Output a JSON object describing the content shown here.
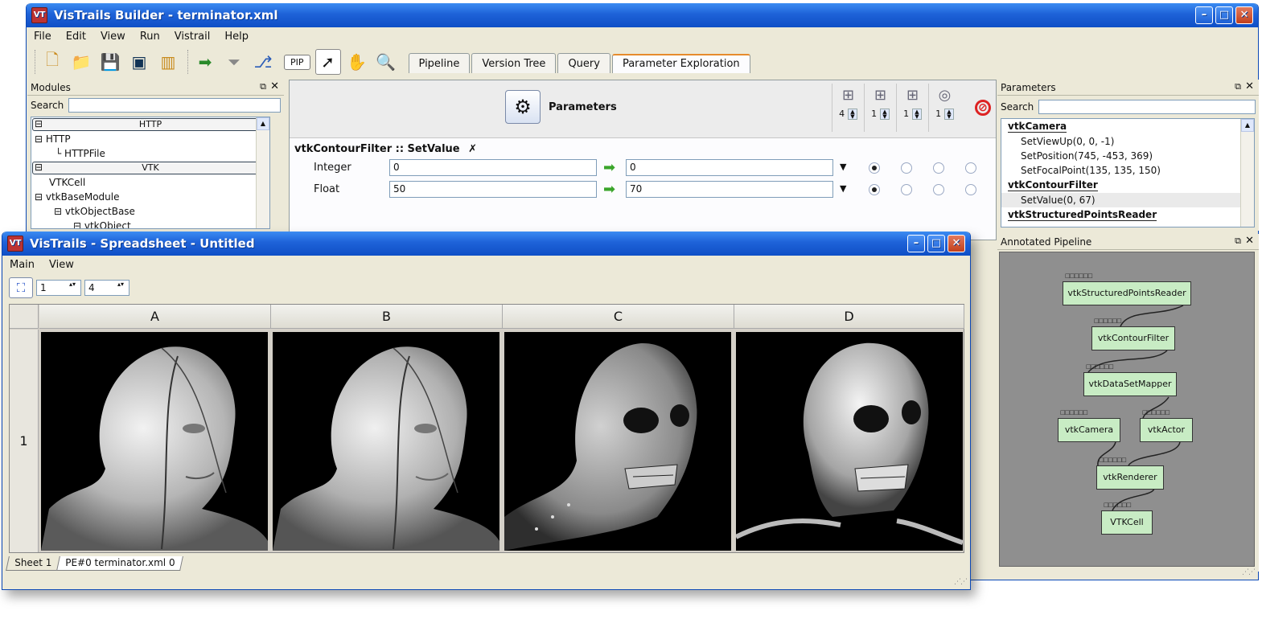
{
  "builder": {
    "title": "VisTrails Builder - terminator.xml",
    "menu": [
      "File",
      "Edit",
      "View",
      "Run",
      "Vistrail",
      "Help"
    ],
    "pip_label": "PIP",
    "tabs": [
      "Pipeline",
      "Version Tree",
      "Query",
      "Parameter Exploration"
    ],
    "active_tab": "Parameter Exploration",
    "modules_panel": {
      "title": "Modules",
      "search_label": "Search",
      "items": [
        {
          "type": "category",
          "label": "HTTP"
        },
        {
          "type": "item",
          "label": "HTTP",
          "indent": 1
        },
        {
          "type": "item",
          "label": "HTTPFile",
          "indent": 3
        },
        {
          "type": "category",
          "label": "VTK"
        },
        {
          "type": "item",
          "label": "VTKCell",
          "indent": 1
        },
        {
          "type": "item",
          "label": "vtkBaseModule",
          "indent": 1
        },
        {
          "type": "item",
          "label": "vtkObjectBase",
          "indent": 2
        },
        {
          "type": "item",
          "label": "vtkObject",
          "indent": 3
        }
      ]
    },
    "exploration": {
      "header_title": "Parameters",
      "dimensions": [
        {
          "value": "4"
        },
        {
          "value": "1"
        },
        {
          "value": "1"
        },
        {
          "value": "1"
        }
      ],
      "function_label": "vtkContourFilter :: SetValue",
      "rows": [
        {
          "label": "Integer",
          "start": "0",
          "end": "0",
          "selected_dim": 0
        },
        {
          "label": "Float",
          "start": "50",
          "end": "70",
          "selected_dim": 0
        }
      ]
    },
    "parameters_panel": {
      "title": "Parameters",
      "search_label": "Search",
      "groups": [
        {
          "name": "vtkCamera",
          "items": [
            "SetViewUp(0, 0, -1)",
            "SetPosition(745, -453, 369)",
            "SetFocalPoint(135, 135, 150)"
          ]
        },
        {
          "name": "vtkContourFilter",
          "items": [
            "SetValue(0, 67)"
          ]
        },
        {
          "name": "vtkStructuredPointsReader",
          "items": []
        }
      ]
    },
    "annotated_pipeline": {
      "title": "Annotated Pipeline",
      "modules": [
        "vtkStructuredPointsReader",
        "vtkContourFilter",
        "vtkDataSetMapper",
        "vtkCamera",
        "vtkActor",
        "vtkRenderer",
        "VTKCell"
      ]
    }
  },
  "spreadsheet": {
    "title": "VisTrails - Spreadsheet - Untitled",
    "menu": [
      "Main",
      "View"
    ],
    "rows_value": "1",
    "cols_value": "4",
    "columns": [
      "A",
      "B",
      "C",
      "D"
    ],
    "rows": [
      "1"
    ],
    "cells": [
      {
        "render": "head"
      },
      {
        "render": "head"
      },
      {
        "render": "skull-partial"
      },
      {
        "render": "skull"
      }
    ],
    "sheet_tabs": [
      "Sheet 1",
      "PE#0 terminator.xml 0"
    ],
    "active_sheet": "PE#0 terminator.xml 0"
  },
  "colors": {
    "titlebar": "#1e62d8",
    "window_bg": "#ece9d8",
    "module_fill": "#c8ecc4",
    "pipeline_bg": "#8f8f8f",
    "tab_accent": "#e68b2c"
  }
}
